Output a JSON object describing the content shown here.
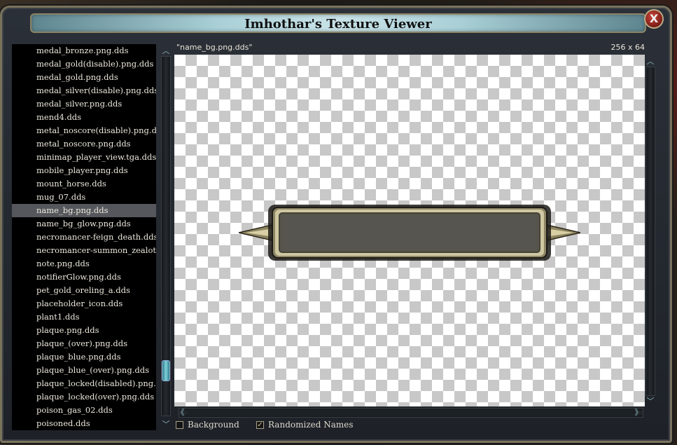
{
  "window": {
    "title": "Imhothar's Texture Viewer",
    "close_glyph": "X"
  },
  "file_list": {
    "selected_index": 12,
    "items": [
      "medal_bronze.png.dds",
      "medal_gold(disable).png.dds",
      "medal_gold.png.dds",
      "medal_silver(disable).png.dds",
      "medal_silver.png.dds",
      "mend4.dds",
      "metal_noscore(disable).png.dds",
      "metal_noscore.png.dds",
      "minimap_player_view.tga.dds",
      "mobile_player.png.dds",
      "mount_horse.dds",
      "mug_07.dds",
      "name_bg.png.dds",
      "name_bg_glow.png.dds",
      "necromancer-feign_death.dds",
      "necromancer-summon_zealot_a.dds",
      "note.png.dds",
      "notifierGlow.png.dds",
      "pet_gold_oreling_a.dds",
      "placeholder_icon.dds",
      "plant1.dds",
      "plaque.png.dds",
      "plaque_(over).png.dds",
      "plaque_blue.png.dds",
      "plaque_blue_(over).png.dds",
      "plaque_locked(disabled).png.dds",
      "plaque_locked(over).png.dds",
      "poison_gas_02.dds",
      "poisoned.dds"
    ]
  },
  "preview": {
    "file_name": "\"name_bg.png.dds\"",
    "dimensions": "256 x 64"
  },
  "options": {
    "background_label": "Background",
    "background_checked": false,
    "randomized_label": "Randomized Names",
    "randomized_checked": true
  },
  "icons": {
    "up_arrow": "up-arrow-icon",
    "down_arrow": "down-arrow-icon",
    "left_arrow": "left-arrow-icon",
    "right_arrow": "right-arrow-icon",
    "close": "close-icon"
  },
  "colors": {
    "title_bar": "#a9cfd6",
    "scroll_thumb": "#7fd0da",
    "selected_row": "#55575c"
  }
}
